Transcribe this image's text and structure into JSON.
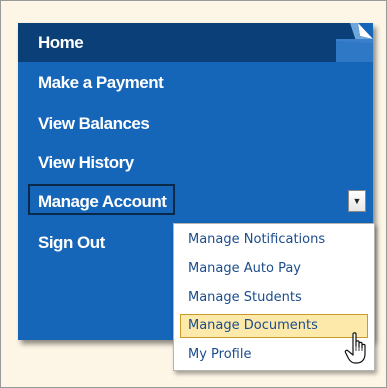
{
  "nav": {
    "home": "Home",
    "make_payment": "Make a Payment",
    "view_balances": "View Balances",
    "view_history": "View History",
    "manage_account": "Manage Account",
    "sign_out": "Sign Out"
  },
  "menu": {
    "items": [
      {
        "label": "Manage Notifications"
      },
      {
        "label": "Manage Auto Pay"
      },
      {
        "label": "Manage Students"
      },
      {
        "label": "Manage Documents"
      },
      {
        "label": "My Profile"
      }
    ],
    "highlighted_index": 3
  },
  "colors": {
    "panel": "#1565b8",
    "home_bar": "#0a3f78",
    "menu_text": "#1b4c8c",
    "highlight_bg": "#fde9a9",
    "highlight_border": "#c89a28"
  },
  "icons": {
    "dropdown": "triangle-down",
    "cursor": "hand-pointer"
  }
}
